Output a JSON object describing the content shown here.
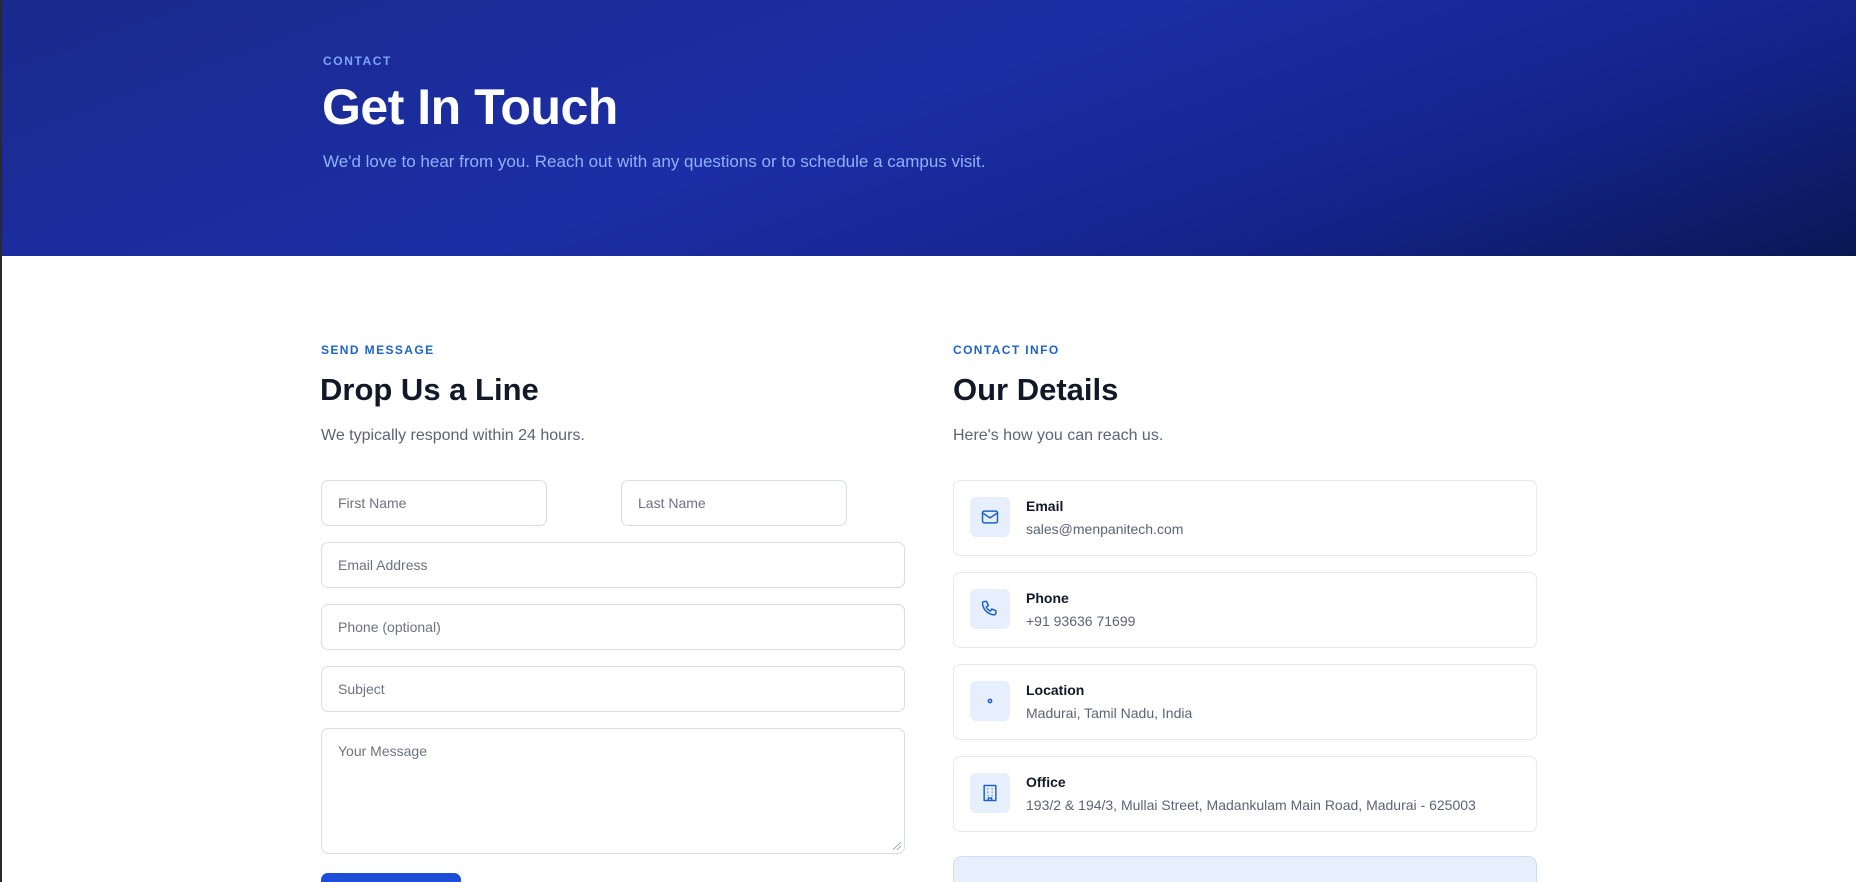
{
  "hero": {
    "eyebrow": "CONTACT",
    "title": "Get In Touch",
    "subtitle": "We'd love to hear from you. Reach out with any questions or to schedule a campus visit."
  },
  "form_section": {
    "eyebrow": "SEND MESSAGE",
    "title": "Drop Us a Line",
    "subtitle": "We typically respond within 24 hours.",
    "fields": {
      "first_name": {
        "placeholder": "First Name",
        "value": ""
      },
      "last_name": {
        "placeholder": "Last Name",
        "value": ""
      },
      "email": {
        "placeholder": "Email Address",
        "value": ""
      },
      "phone": {
        "placeholder": "Phone (optional)",
        "value": ""
      },
      "subject": {
        "placeholder": "Subject",
        "value": ""
      },
      "message": {
        "placeholder": "Your Message",
        "value": ""
      }
    }
  },
  "info_section": {
    "eyebrow": "CONTACT INFO",
    "title": "Our Details",
    "subtitle": "Here's how you can reach us.",
    "items": [
      {
        "icon": "mail-icon",
        "label": "Email",
        "value": "sales@menpanitech.com"
      },
      {
        "icon": "phone-icon",
        "label": "Phone",
        "value": "+91 93636 71699"
      },
      {
        "icon": "location-icon",
        "label": "Location",
        "value": "Madurai, Tamil Nadu, India"
      },
      {
        "icon": "building-icon",
        "label": "Office",
        "value": "193/2 & 194/3, Mullai Street, Madankulam Main Road, Madurai - 625003"
      }
    ]
  },
  "colors": {
    "accent": "#1d4ed8",
    "eyebrow": "#1d63c7",
    "hero_bg": "#1c2ea6",
    "icon_bg": "#e8effc"
  }
}
